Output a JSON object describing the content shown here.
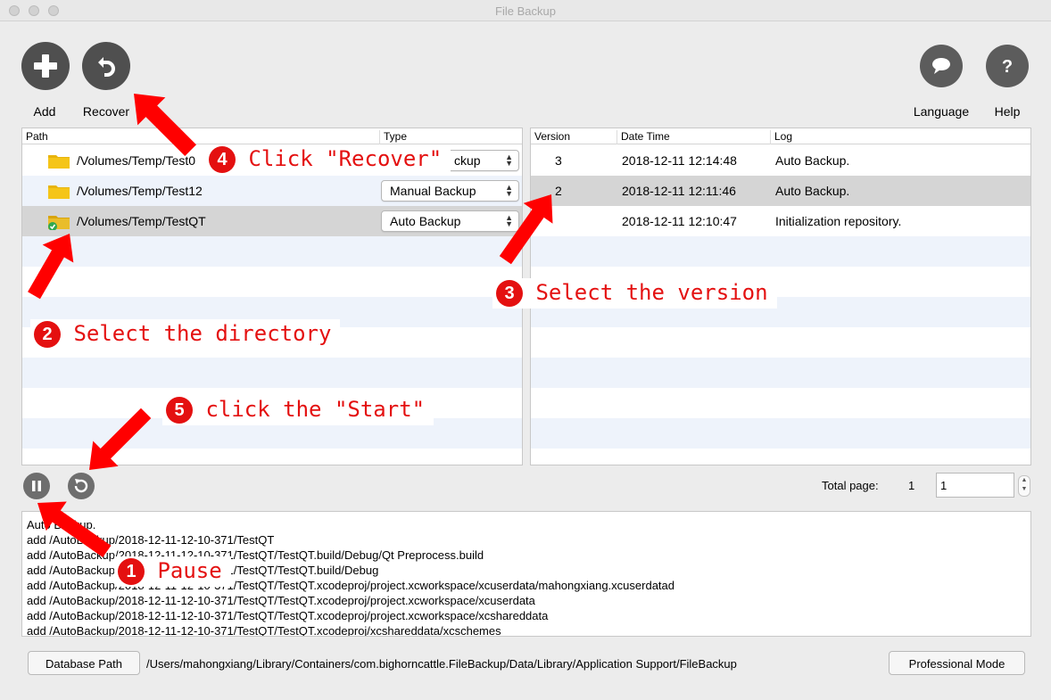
{
  "window": {
    "title": "File Backup"
  },
  "toolbar": {
    "add_label": "Add",
    "recover_label": "Recover",
    "language_label": "Language",
    "help_label": "Help"
  },
  "paths_table": {
    "headers": {
      "path": "Path",
      "type": "Type"
    },
    "rows": [
      {
        "path": "/Volumes/Temp/Test0",
        "type": "Auto Backup",
        "type_visible": "ckup",
        "selected": false
      },
      {
        "path": "/Volumes/Temp/Test12",
        "type": "Manual Backup",
        "selected": false
      },
      {
        "path": "/Volumes/Temp/TestQT",
        "type": "Auto Backup",
        "selected": true
      }
    ]
  },
  "versions_table": {
    "headers": {
      "version": "Version",
      "datetime": "Date Time",
      "log": "Log"
    },
    "rows": [
      {
        "version": "3",
        "datetime": "2018-12-11 12:14:48",
        "log": "Auto Backup."
      },
      {
        "version": "2",
        "datetime": "2018-12-11 12:11:46",
        "log": "Auto Backup."
      },
      {
        "version": "",
        "datetime": "2018-12-11 12:10:47",
        "log": "Initialization repository."
      }
    ]
  },
  "pagination": {
    "total_label": "Total page:",
    "total_value": "1",
    "current": "1"
  },
  "log_lines": [
    {
      "text": "Auto Backup."
    },
    {
      "text": "add   /AutoBackup/2018-12-11-12-10-371/TestQT"
    },
    {
      "text": "add   /AutoBackup/2018-12-11-12-10-371/TestQT/TestQT.build/Debug/Qt Preprocess.build"
    },
    {
      "text": "add   /AutoBackup/2018-12-11-12-10-371/TestQT/TestQT.build/Debug"
    },
    {
      "text": "add   /AutoBackup/2018-12-11-12-10-371/TestQT/TestQT.xcodeproj/project.xcworkspace/xcuserdata/mahongxiang.xcuserdatad"
    },
    {
      "text": "add   /AutoBackup/2018-12-11-12-10-371/TestQT/TestQT.xcodeproj/project.xcworkspace/xcuserdata"
    },
    {
      "text": "add   /AutoBackup/2018-12-11-12-10-371/TestQT/TestQT.xcodeproj/project.xcworkspace/xcshareddata"
    },
    {
      "text": "add   /AutoBackup/2018-12-11-12-10-371/TestQT/TestQT.xcodeproj/xcshareddata/xcschemes"
    }
  ],
  "footer": {
    "database_button": "Database Path",
    "database_path": "/Users/mahongxiang/Library/Containers/com.bighorncattle.FileBackup/Data/Library/Application Support/FileBackup",
    "professional_button": "Professional Mode"
  },
  "annotations": [
    {
      "num": "1",
      "text": "Pause"
    },
    {
      "num": "2",
      "text": "Select the directory"
    },
    {
      "num": "3",
      "text": "Select the version"
    },
    {
      "num": "4",
      "text": "Click \"Recover\""
    },
    {
      "num": "5",
      "text": "click the \"Start\""
    }
  ],
  "colors": {
    "annotation_red": "#e41010",
    "selected_row": "#d5d5d5",
    "alt_row": "#eef3fb",
    "toolbar_button": "#4f4f4f"
  }
}
